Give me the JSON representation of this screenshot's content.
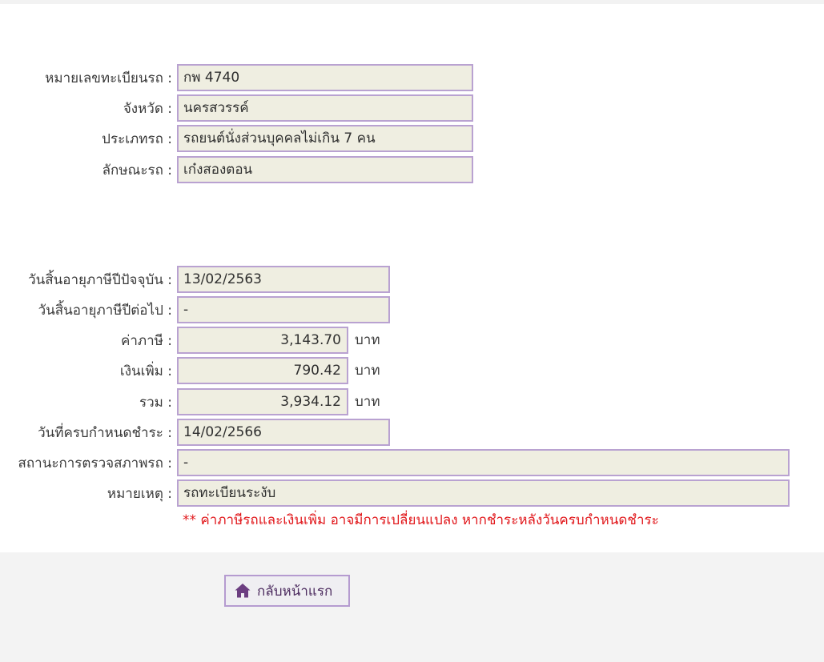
{
  "vehicle": {
    "plate_label": "หมายเลขทะเบียนรถ :",
    "plate_value": "กพ 4740",
    "province_label": "จังหวัด :",
    "province_value": "นครสวรรค์",
    "type_label": "ประเภทรถ :",
    "type_value": "รถยนต์นั่งส่วนบุคคลไม่เกิน 7 คน",
    "body_label": "ลักษณะรถ :",
    "body_value": "เก๋งสองตอน"
  },
  "tax": {
    "expiry_current_label": "วันสิ้นอายุภาษีปีปัจจุบัน :",
    "expiry_current_value": "13/02/2563",
    "expiry_next_label": "วันสิ้นอายุภาษีปีต่อไป :",
    "expiry_next_value": "-",
    "tax_amount_label": "ค่าภาษี :",
    "tax_amount_value": "3,143.70",
    "surcharge_label": "เงินเพิ่ม :",
    "surcharge_value": "790.42",
    "total_label": "รวม :",
    "total_value": "3,934.12",
    "currency_unit": "บาท",
    "due_date_label": "วันที่ครบกำหนดชำระ :",
    "due_date_value": "14/02/2566",
    "inspection_status_label": "สถานะการตรวจสภาพรถ :",
    "inspection_status_value": "-",
    "remark_label": "หมายเหตุ :",
    "remark_value": "รถทะเบียนระงับ",
    "warning_note": "** ค่าภาษีรถและเงินเพิ่ม อาจมีการเปลี่ยนแปลง หากชำระหลังวันครบกำหนดชำระ"
  },
  "footer": {
    "home_button_label": "กลับหน้าแรก",
    "home_icon": "home-icon"
  },
  "colors": {
    "field_background": "#efeee1",
    "field_border": "#b9a2d1",
    "warning_text": "#e1171b",
    "button_text": "#4b2a5e",
    "home_icon": "#6b3d80"
  }
}
